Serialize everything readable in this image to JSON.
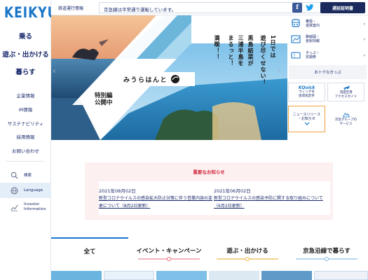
{
  "brand": {
    "logo_text": "KEIKYU",
    "accent": "#1a76c8",
    "navy": "#1a2a5c"
  },
  "sidebar": {
    "main": [
      {
        "label": "乗る"
      },
      {
        "label": "遊ぶ・出かける"
      },
      {
        "label": "暮らす"
      }
    ],
    "sub": [
      {
        "label": "企業情報"
      },
      {
        "label": "IR情報"
      },
      {
        "label": "サステナビリティ"
      },
      {
        "label": "採用情報"
      },
      {
        "label": "お問い合わせ"
      }
    ],
    "buttons": [
      {
        "label": "検索",
        "icon": "search-icon"
      },
      {
        "label": "Language",
        "icon": "globe-icon"
      },
      {
        "label_1": "Investor",
        "label_2": "Information",
        "icon": "chart-icon"
      }
    ]
  },
  "topbar": {
    "ops_label": "鉄道運行情報",
    "ops_status": "京急線は平常通り運転しています。",
    "certificate_button": "遅延証明書"
  },
  "hero": {
    "vertical_lines": [
      "1日では",
      "遊び尽くせない！",
      "黒島結菜が",
      "三浦半島を",
      "まるっと！",
      "満喫！！"
    ],
    "tagline": "みうらはんと",
    "badge_1": "特別編",
    "badge_2": "公開中",
    "slide_count": 3,
    "active_slide": 1
  },
  "quick_links": {
    "rows": [
      {
        "line_1": "乗換・",
        "line_2": "運賃案内",
        "icon": "train-icon"
      },
      {
        "line_1": "路線図・",
        "line_2": "各駅情報",
        "icon": "route-map-icon"
      },
      {
        "line_1": "きっぷ・",
        "line_2": "定期券",
        "icon": "ticket-icon"
      }
    ],
    "otoku": "おトクなきっぷ",
    "tiles": [
      {
        "logo": "KQuick",
        "line_1": "ウィング号",
        "line_2": "座席指定券"
      },
      {
        "line_1": "羽田空港",
        "line_2": "アクセスガイド"
      }
    ],
    "news": {
      "line_1": "ニュースリリース",
      "line_2": "・お知らせ"
    },
    "group": {
      "line_1": "京急グループの",
      "line_2": "サービス"
    }
  },
  "notice": {
    "title": "重要なお知らせ",
    "items": [
      {
        "date": "2021年08月02日",
        "text": "新型コロナウイルスの感染拡大防止対策に伴う営業内容の変更について（8月2日更新）"
      },
      {
        "date": "2021年06月02日",
        "text": "新型コロナウイルスの感染予防に関する取り組みについて（6月2日更新）"
      }
    ]
  },
  "tabs": [
    {
      "label": "全て",
      "color": "#1a76c8"
    },
    {
      "label": "イベント・キャンペーン",
      "color": "#e86a7a"
    },
    {
      "label": "遊ぶ・出かける",
      "color": "#f0b640"
    },
    {
      "label": "京急沿線で暮らす",
      "color": "#7ab8e6"
    }
  ]
}
